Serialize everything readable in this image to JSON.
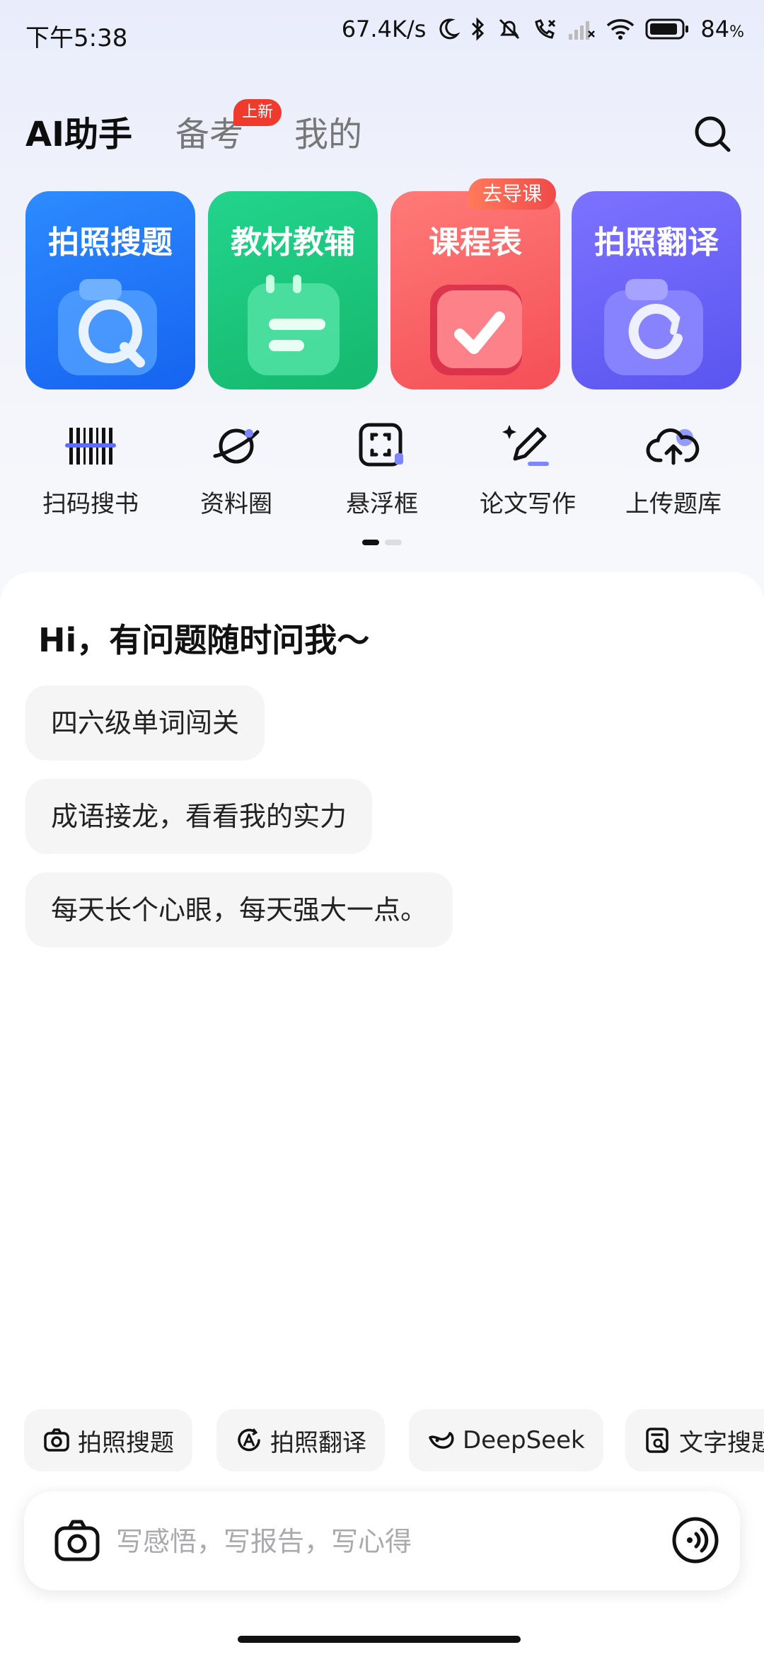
{
  "status_bar": {
    "time": "下午5:38",
    "network_speed": "67.4K/s",
    "battery": "84",
    "battery_unit": "%"
  },
  "top_nav": {
    "tabs": [
      "AI助手",
      "备考",
      "我的"
    ],
    "badge": "上新"
  },
  "feature_cards": [
    {
      "title": "拍照搜题"
    },
    {
      "title": "教材教辅"
    },
    {
      "title": "课程表",
      "badge": "去导课"
    },
    {
      "title": "拍照翻译"
    }
  ],
  "tools": [
    {
      "label": "扫码搜书",
      "icon": "barcode-scan-icon"
    },
    {
      "label": "资料圈",
      "icon": "planet-icon"
    },
    {
      "label": "悬浮框",
      "icon": "floating-window-icon"
    },
    {
      "label": "论文写作",
      "icon": "pen-write-icon"
    },
    {
      "label": "上传题库",
      "icon": "cloud-upload-icon"
    }
  ],
  "chat": {
    "greeting": "Hi，有问题随时问我～",
    "suggestions": [
      "四六级单词闯关",
      "成语接龙，看看我的实力",
      "每天长个心眼，每天强大一点。"
    ]
  },
  "quick_actions": [
    {
      "label": "拍照搜题",
      "icon": "camera-icon"
    },
    {
      "label": "拍照翻译",
      "icon": "translate-icon"
    },
    {
      "label": "DeepSeek",
      "icon": "deepseek-icon"
    },
    {
      "label": "文字搜题",
      "icon": "text-search-icon"
    }
  ],
  "input": {
    "placeholder": "写感悟，写报告，写心得"
  },
  "colors": {
    "blue": "#1f74ff",
    "green": "#1cc57c",
    "red": "#f55a5e",
    "purple": "#6b63f7",
    "badge_red": "#ef3b2d"
  }
}
